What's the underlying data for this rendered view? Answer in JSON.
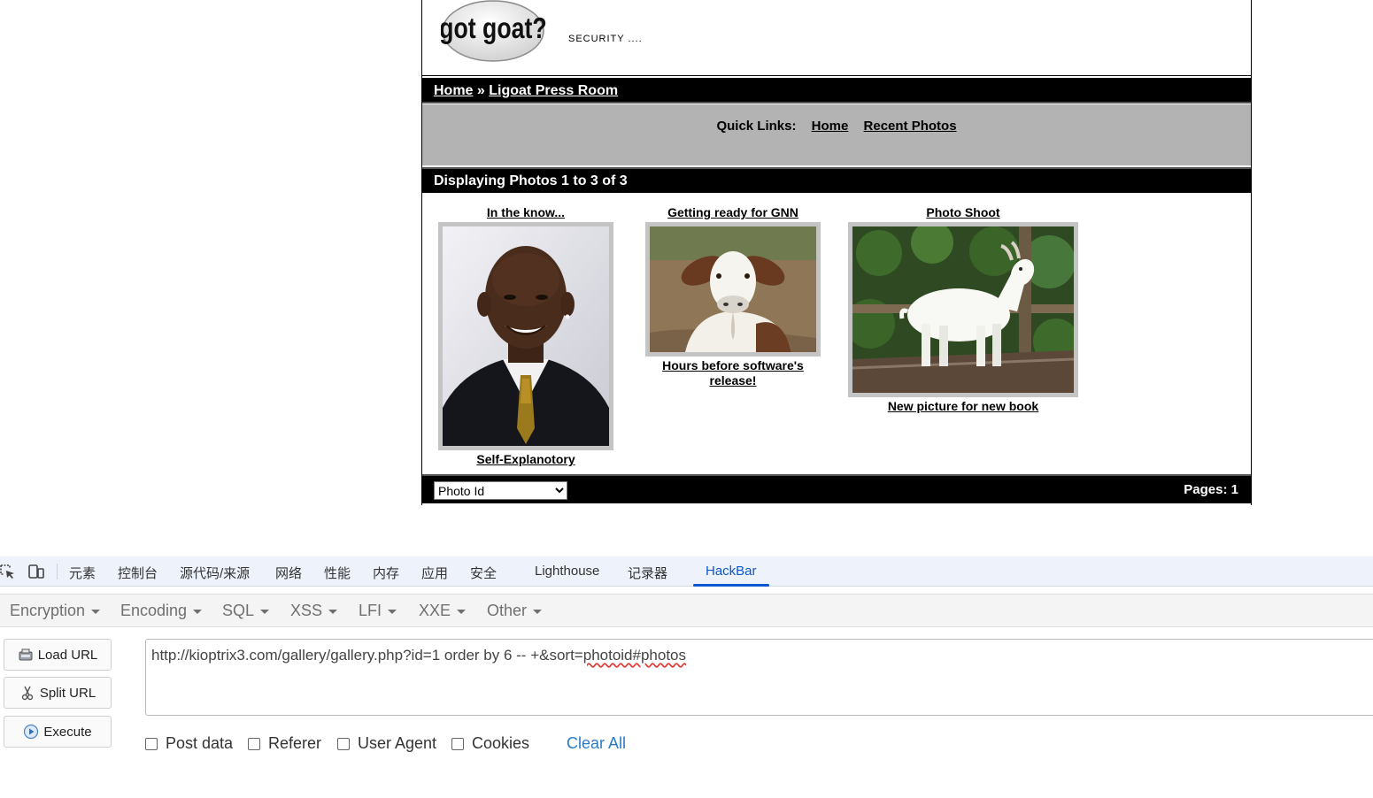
{
  "site": {
    "logo_text": "got goat?",
    "tagline": "SECURITY ....",
    "breadcrumb": {
      "home": "Home",
      "separator": "»",
      "current": "Ligoat Press Room"
    },
    "quick_links": {
      "label": "Quick Links:",
      "home": "Home",
      "recent": "Recent Photos"
    },
    "displaying": "Displaying Photos 1 to 3 of 3",
    "photos": [
      {
        "title": "In the know...",
        "caption": "Self-Explanotory"
      },
      {
        "title": "Getting ready for GNN",
        "caption_line1": "Hours before software's",
        "caption_line2": "release!"
      },
      {
        "title": "Photo Shoot",
        "caption": "New picture for new book"
      }
    ],
    "sort_select": "Photo Id",
    "pages": "Pages: 1"
  },
  "devtools": {
    "tabs": [
      "元素",
      "控制台",
      "源代码/来源",
      "网络",
      "性能",
      "内存",
      "应用",
      "安全",
      "Lighthouse",
      "记录器",
      "HackBar"
    ],
    "active_tab": "HackBar",
    "icons": [
      "inspect-element-icon",
      "device-toolbar-icon"
    ]
  },
  "hackbar": {
    "menu": [
      "Encryption",
      "Encoding",
      "SQL",
      "XSS",
      "LFI",
      "XXE",
      "Other"
    ],
    "buttons": {
      "load": "Load URL",
      "split": "Split URL",
      "execute": "Execute"
    },
    "url_main": "http://kioptrix3.com/gallery/gallery.php?id=1 order by 6 -- +&sort=",
    "url_squiggle": "photoid#photos",
    "options": [
      "Post data",
      "Referer",
      "User Agent",
      "Cookies"
    ],
    "clear_all": "Clear All"
  },
  "colors": {
    "accent": "#0b57d0",
    "link": "#2a7cc7",
    "site_bar": "#000000",
    "quicklinks_bg": "#b3b3b3"
  }
}
